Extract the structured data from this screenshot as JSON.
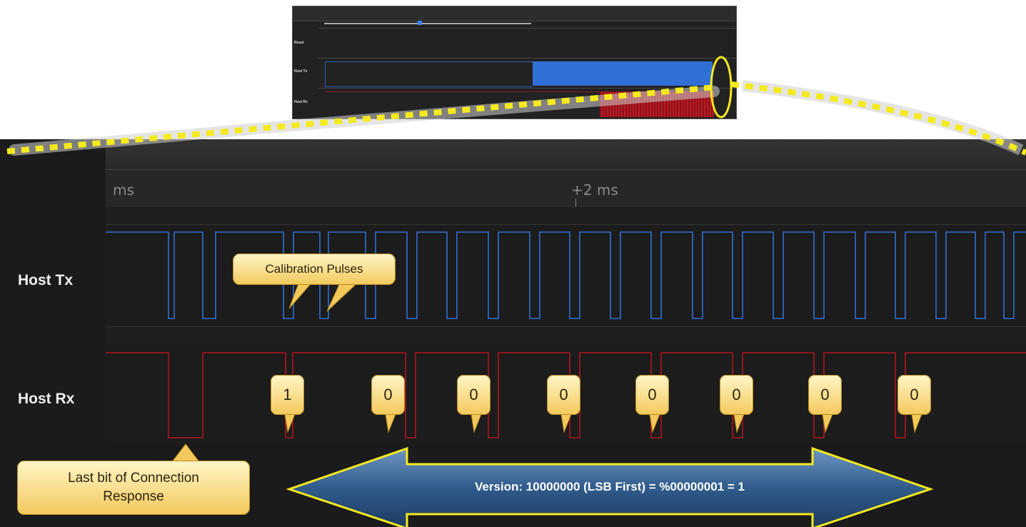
{
  "overview": {
    "labels": [
      "Reset",
      "Host Tx",
      "Host Rx"
    ]
  },
  "timeline": {
    "ruler_left": "ms",
    "ruler_center": "+2 ms"
  },
  "channels": {
    "tx_label": "Host Tx",
    "rx_label": "Host Rx"
  },
  "callouts": {
    "calibration": "Calibration Pulses",
    "last_bit_line1": "Last bit of Connection",
    "last_bit_line2": "Response",
    "bits": [
      "1",
      "0",
      "0",
      "0",
      "0",
      "0",
      "0",
      "0"
    ]
  },
  "arrow": {
    "text": "Version: 10000000 (LSB First) = %00000001 = 1"
  },
  "colors": {
    "tx_signal": "#2f6fd6",
    "rx_signal": "#b3141c",
    "highlight": "#f6ea1f",
    "callout_fill": "#f6d57a",
    "arrow_fill": "#2f5a8a"
  }
}
